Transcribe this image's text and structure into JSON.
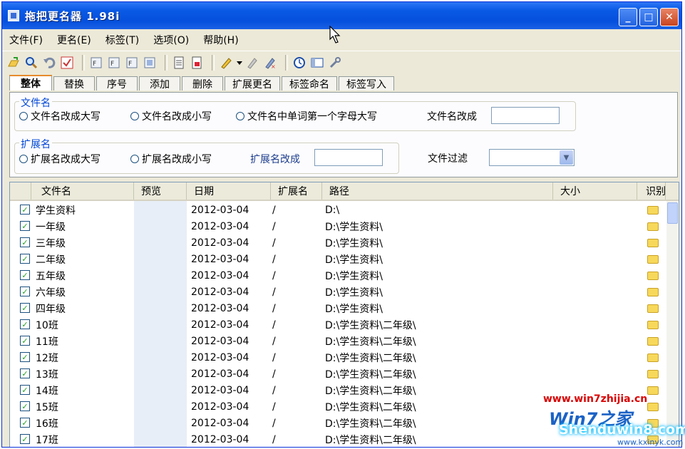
{
  "window": {
    "title": "拖把更名器 1.98i",
    "controls": [
      "minimize-icon",
      "maximize-icon",
      "close-icon"
    ]
  },
  "menu": [
    "文件(F)",
    "更名(E)",
    "标签(T)",
    "选项(O)",
    "帮助(H)"
  ],
  "toolbar_icons": [
    "open-icon",
    "search-icon",
    "undo-icon",
    "check-icon",
    "sep",
    "rename-1-icon",
    "rename-2-icon",
    "rename-3-icon",
    "rename-4-icon",
    "sep",
    "doc-icon",
    "doc-red-icon",
    "sep",
    "pen-icon",
    "dropdown-icon",
    "tag-1-icon",
    "tag-2-icon",
    "sep",
    "clock-icon",
    "window-icon",
    "tools-icon"
  ],
  "tabs": [
    "整体",
    "替换",
    "序号",
    "添加",
    "删除",
    "扩展更名",
    "标签命名",
    "标签写入"
  ],
  "active_tab": 0,
  "filename_group": {
    "legend": "文件名",
    "upper": "文件名改成大写",
    "lower": "文件名改成小写",
    "capitalize": "文件名中单词第一个字母大写",
    "rename_to": "文件名改成",
    "rename_value": ""
  },
  "ext_group": {
    "legend": "扩展名",
    "upper": "扩展名改成大写",
    "lower": "扩展名改成小写",
    "rename_to": "扩展名改成",
    "rename_value": ""
  },
  "filter": {
    "label": "文件过滤",
    "value": ""
  },
  "columns": [
    "文件名",
    "预览",
    "日期",
    "扩展名",
    "路径",
    "大小",
    "识别"
  ],
  "rows": [
    {
      "name": "学生资料",
      "date": "2012-03-04",
      "ext": "/",
      "path": "D:\\"
    },
    {
      "name": "一年级",
      "date": "2012-03-04",
      "ext": "/",
      "path": "D:\\学生资料\\"
    },
    {
      "name": "三年级",
      "date": "2012-03-04",
      "ext": "/",
      "path": "D:\\学生资料\\"
    },
    {
      "name": "二年级",
      "date": "2012-03-04",
      "ext": "/",
      "path": "D:\\学生资料\\"
    },
    {
      "name": "五年级",
      "date": "2012-03-04",
      "ext": "/",
      "path": "D:\\学生资料\\"
    },
    {
      "name": "六年级",
      "date": "2012-03-04",
      "ext": "/",
      "path": "D:\\学生资料\\"
    },
    {
      "name": "四年级",
      "date": "2012-03-04",
      "ext": "/",
      "path": "D:\\学生资料\\"
    },
    {
      "name": "10班",
      "date": "2012-03-04",
      "ext": "/",
      "path": "D:\\学生资料\\二年级\\"
    },
    {
      "name": "11班",
      "date": "2012-03-04",
      "ext": "/",
      "path": "D:\\学生资料\\二年级\\"
    },
    {
      "name": "12班",
      "date": "2012-03-04",
      "ext": "/",
      "path": "D:\\学生资料\\二年级\\"
    },
    {
      "name": "13班",
      "date": "2012-03-04",
      "ext": "/",
      "path": "D:\\学生资料\\二年级\\"
    },
    {
      "name": "14班",
      "date": "2012-03-04",
      "ext": "/",
      "path": "D:\\学生资料\\二年级\\"
    },
    {
      "name": "15班",
      "date": "2012-03-04",
      "ext": "/",
      "path": "D:\\学生资料\\二年级\\"
    },
    {
      "name": "16班",
      "date": "2012-03-04",
      "ext": "/",
      "path": "D:\\学生资料\\二年级\\"
    },
    {
      "name": "17班",
      "date": "2012-03-04",
      "ext": "/",
      "path": "D:\\学生资料\\二年级\\"
    }
  ],
  "watermark": {
    "url1": "www.win7zhijia.cn",
    "brand": "Win7之家",
    "url2": "Shenduwin8.com",
    "url3": "www.kxinyk.com"
  }
}
